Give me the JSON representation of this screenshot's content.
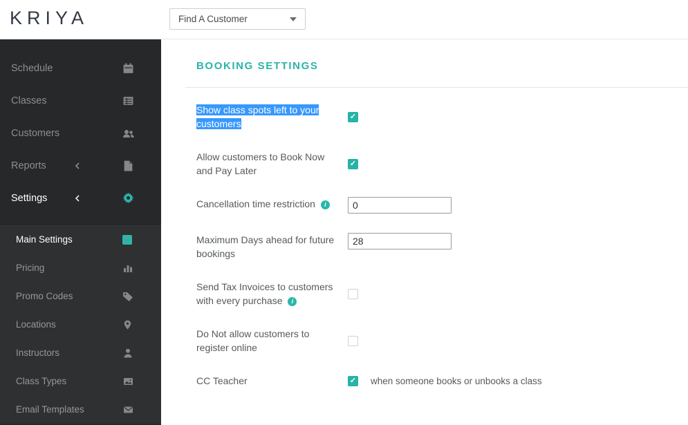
{
  "header": {
    "logo_text": "KRIYA",
    "customer_dropdown": {
      "label": "Find A Customer"
    }
  },
  "sidebar": {
    "items": [
      {
        "label": "Schedule"
      },
      {
        "label": "Classes"
      },
      {
        "label": "Customers"
      },
      {
        "label": "Reports"
      },
      {
        "label": "Settings"
      }
    ],
    "settings_items": [
      {
        "label": "Main Settings"
      },
      {
        "label": "Pricing"
      },
      {
        "label": "Promo Codes"
      },
      {
        "label": "Locations"
      },
      {
        "label": "Instructors"
      },
      {
        "label": "Class Types"
      },
      {
        "label": "Email Templates"
      }
    ]
  },
  "main": {
    "title": "BOOKING SETTINGS",
    "rows": [
      {
        "label": "Show class spots left to your customers",
        "control": "checkbox",
        "checked": true,
        "highlighted": true
      },
      {
        "label": "Allow customers to Book Now and Pay Later",
        "control": "checkbox",
        "checked": true
      },
      {
        "label": "Cancellation time restriction",
        "info": true,
        "control": "input",
        "value": "0"
      },
      {
        "label": "Maximum Days ahead for future bookings",
        "control": "input",
        "value": "28"
      },
      {
        "label": "Send Tax Invoices to customers with every purchase",
        "info": true,
        "control": "checkbox",
        "checked": false
      },
      {
        "label": "Do Not allow customers to register online",
        "control": "checkbox",
        "checked": false
      },
      {
        "label": "CC Teacher",
        "control": "checkbox",
        "checked": true,
        "suffix": "when someone books or unbooks a class"
      }
    ]
  },
  "colors": {
    "accent": "#2ab7a9",
    "selection": "#3798fd",
    "sidebar_bg": "#26282a"
  }
}
